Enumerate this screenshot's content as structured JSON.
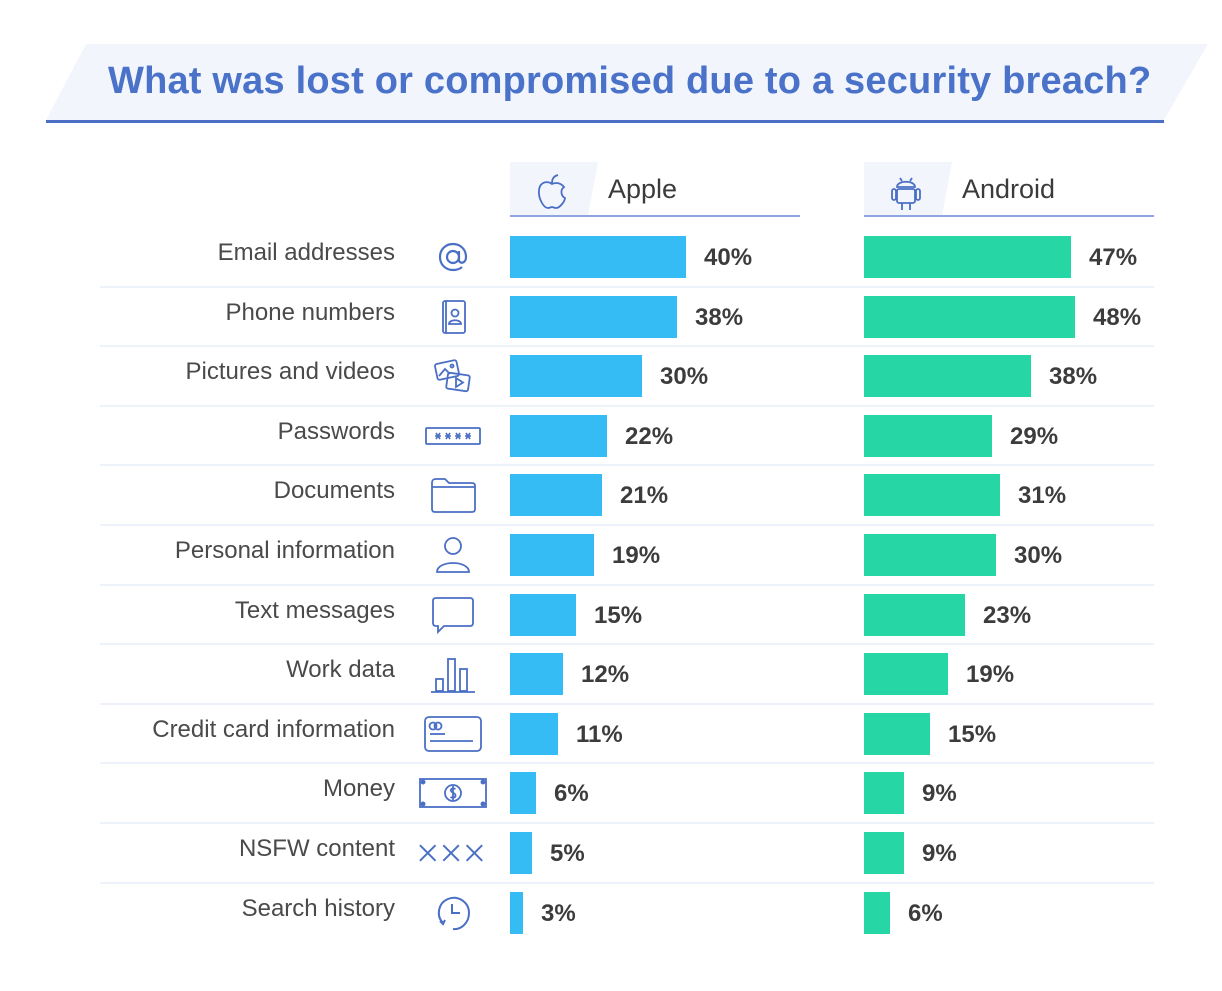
{
  "chart_data": {
    "type": "bar",
    "orientation": "horizontal",
    "title": "What was lost or compromised due to a security breach?",
    "xlabel": "",
    "ylabel": "",
    "value_suffix": "%",
    "xlim": [
      0,
      50
    ],
    "grid": false,
    "legend_position": "top",
    "categories": [
      "Email addresses",
      "Phone numbers",
      "Pictures and videos",
      "Passwords",
      "Documents",
      "Personal information",
      "Text messages",
      "Work data",
      "Credit card information",
      "Money",
      "NSFW content",
      "Search history"
    ],
    "category_icons": [
      "at-sign-icon",
      "contact-book-icon",
      "photo-video-icon",
      "password-field-icon",
      "folder-icon",
      "person-icon",
      "chat-bubble-icon",
      "bar-chart-icon",
      "credit-card-icon",
      "banknote-icon",
      "xxx-icon",
      "history-clock-icon"
    ],
    "series": [
      {
        "name": "Apple",
        "icon": "apple-logo-icon",
        "color": "#35bcf5",
        "values": [
          40,
          38,
          30,
          22,
          21,
          19,
          15,
          12,
          11,
          6,
          5,
          3
        ]
      },
      {
        "name": "Android",
        "icon": "android-logo-icon",
        "color": "#27d6a5",
        "values": [
          47,
          48,
          38,
          29,
          31,
          30,
          23,
          19,
          15,
          9,
          9,
          6
        ]
      }
    ]
  },
  "colors": {
    "title": "#4a72c9",
    "accent_rule": "#4a6fc5",
    "icon_stroke": "#4a6fc5"
  }
}
